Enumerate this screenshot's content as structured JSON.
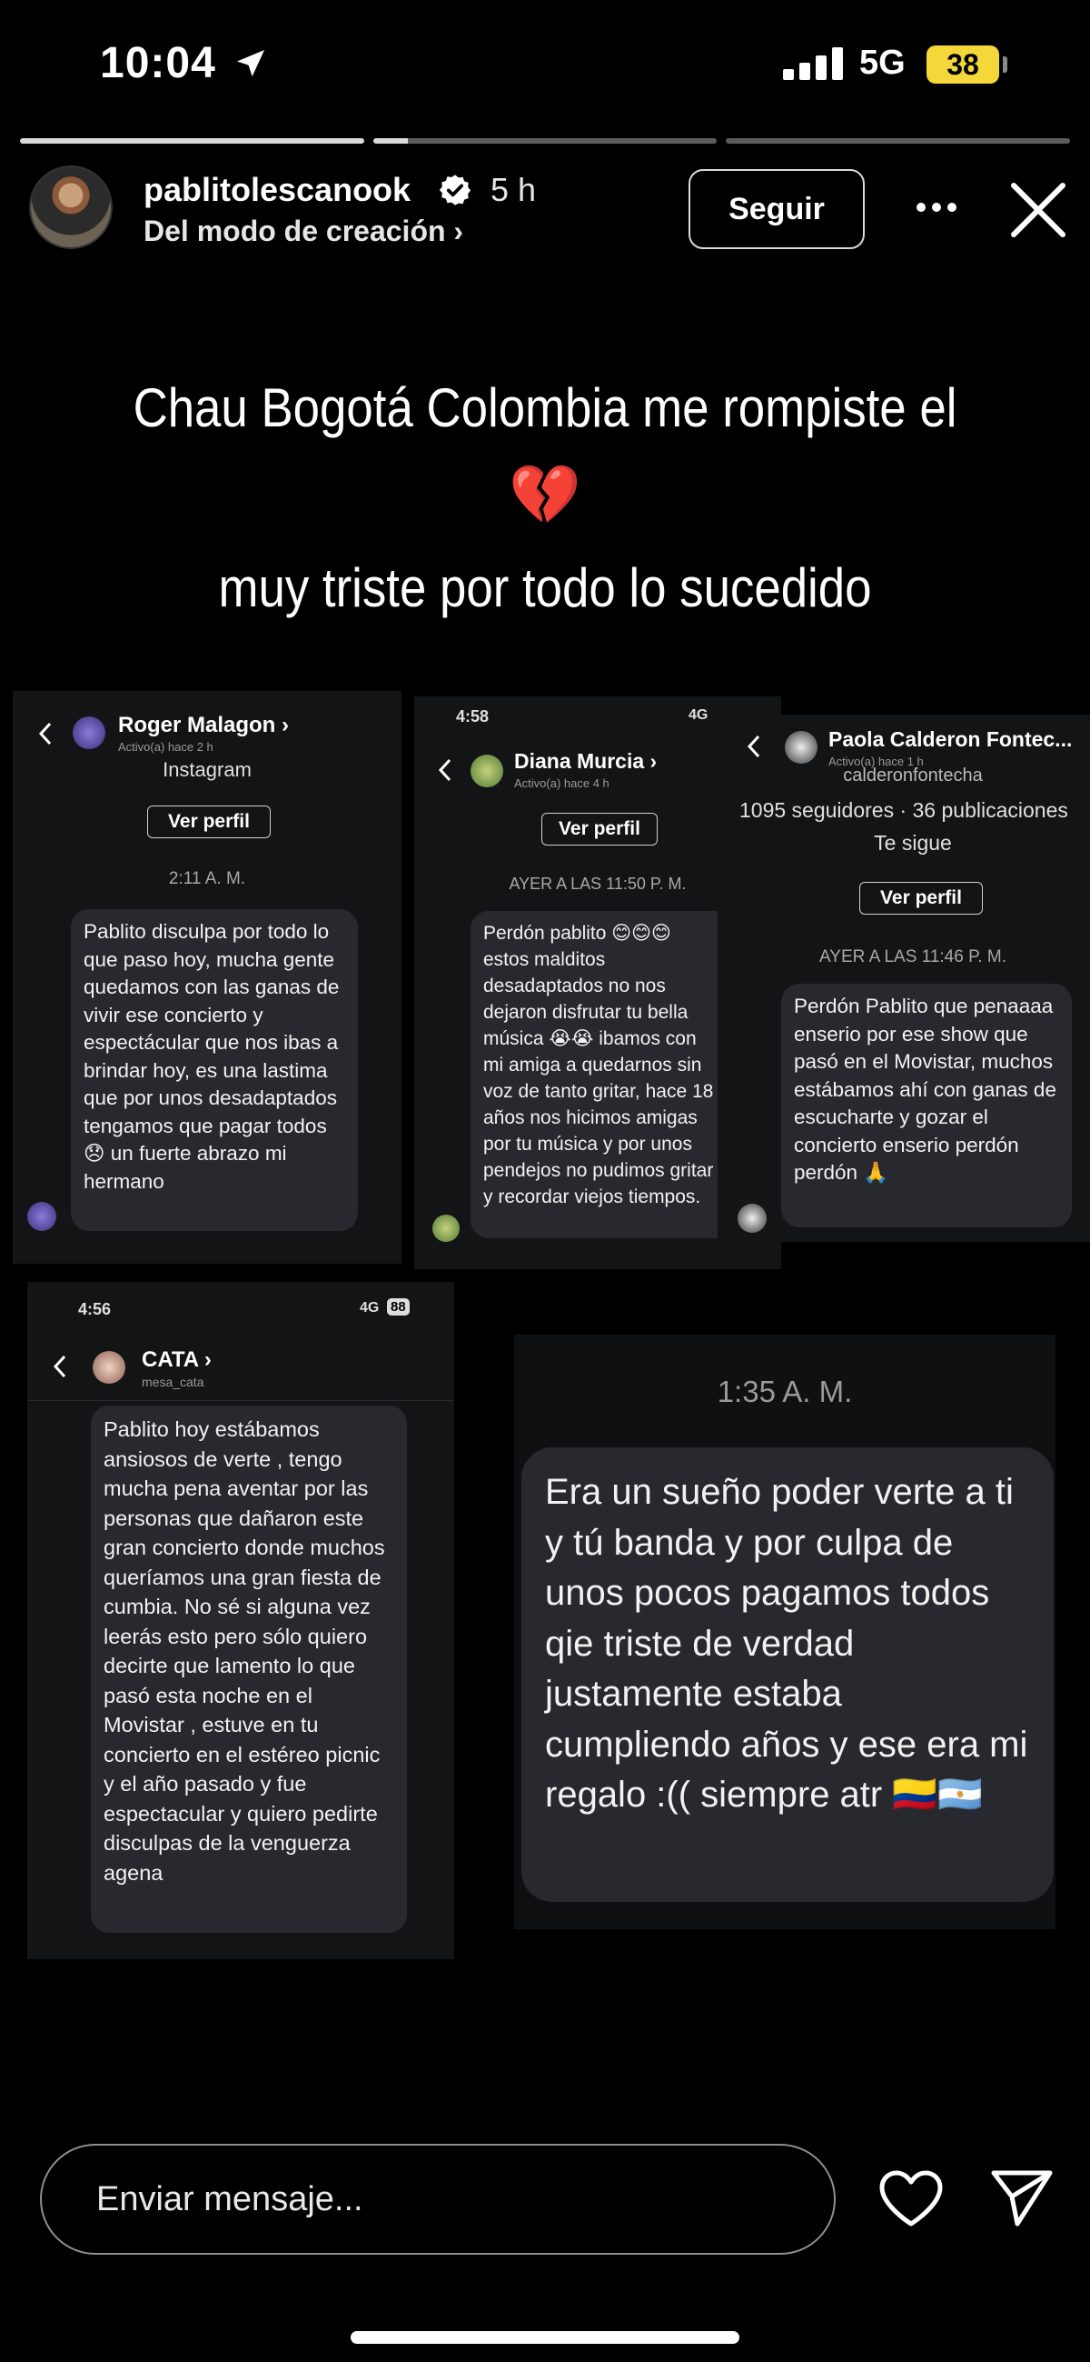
{
  "status_bar": {
    "time": "10:04",
    "network": "5G",
    "battery": "38"
  },
  "story": {
    "username": "pablitolescanook",
    "time_ago": "5 h",
    "subtitle": "Del modo de creación ›",
    "follow_label": "Seguir",
    "progress": {
      "segments": 3,
      "current": 2
    }
  },
  "caption": {
    "line1": "Chau Bogotá Colombia me rompiste el",
    "heart": "💔",
    "line2": "muy triste por todo lo sucedido"
  },
  "screenshots": {
    "roger": {
      "name": "Roger Malagon ›",
      "active": "Activo(a) hace 2 h",
      "app": "Instagram",
      "profile_btn": "Ver perfil",
      "stamp": "2:11 A. M.",
      "message": "Pablito disculpa por todo lo que paso hoy, mucha gente quedamos con las ganas de vivir ese concierto y espectácular que nos ibas a brindar hoy, es una lastima que por unos desadaptados tengamos que pagar todos 😞 un fuerte abrazo mi hermano"
    },
    "diana": {
      "clock": "4:58",
      "network": "4G",
      "name": "Diana Murcia ›",
      "active": "Activo(a) hace 4 h",
      "profile_btn": "Ver perfil",
      "stamp": "AYER A LAS 11:50 P. M.",
      "message": "Perdón pablito 😊😊😊 estos malditos desadaptados no nos dejaron disfrutar tu bella música 😭😭 ibamos con mi amiga a quedarnos sin voz de tanto gritar, hace 18 años nos hicimos amigas por tu música y por unos pendejos no pudimos gritar y recordar viejos tiempos."
    },
    "paola": {
      "name": "Paola Calderon Fontec...",
      "active": "Activo(a) hace 1 h",
      "handle": "calderonfontecha",
      "followers": "1095 seguidores · 36 publicaciones",
      "follows_you": "Te sigue",
      "profile_btn": "Ver perfil",
      "stamp": "AYER A LAS 11:46 P. M.",
      "message": "Perdón Pablito que penaaaa enserio por ese show que pasó en el Movistar, muchos estábamos ahí con ganas de escucharte y gozar el concierto enserio perdón perdón 🙏"
    },
    "cata": {
      "clock": "4:56",
      "network": "4G",
      "battery": "88",
      "name": "CATA ›",
      "handle": "mesa_cata",
      "message": "Pablito hoy estábamos ansiosos de verte , tengo mucha pena aventar por las personas que dañaron este gran concierto donde muchos queríamos una gran fiesta de cumbia. No sé si alguna vez leerás esto pero sólo quiero decirte que lamento lo que pasó esta noche en el Movistar , estuve en tu concierto en el estéreo picnic y el año pasado y fue espectacular y quiero pedirte disculpas de la venguerza agena"
    },
    "last": {
      "stamp": "1:35 A. M.",
      "message": "Era un sueño poder verte a ti y tú banda y por culpa de unos pocos pagamos todos qie triste de verdad justamente estaba cumpliendo años y ese era mi regalo :(( siempre atr 🇨🇴🇦🇷"
    }
  },
  "reply_bar": {
    "placeholder": "Enviar mensaje..."
  },
  "colors": {
    "background": "#000000",
    "card": "#131416",
    "bubble": "#27292e",
    "battery": "#f4d83a"
  }
}
